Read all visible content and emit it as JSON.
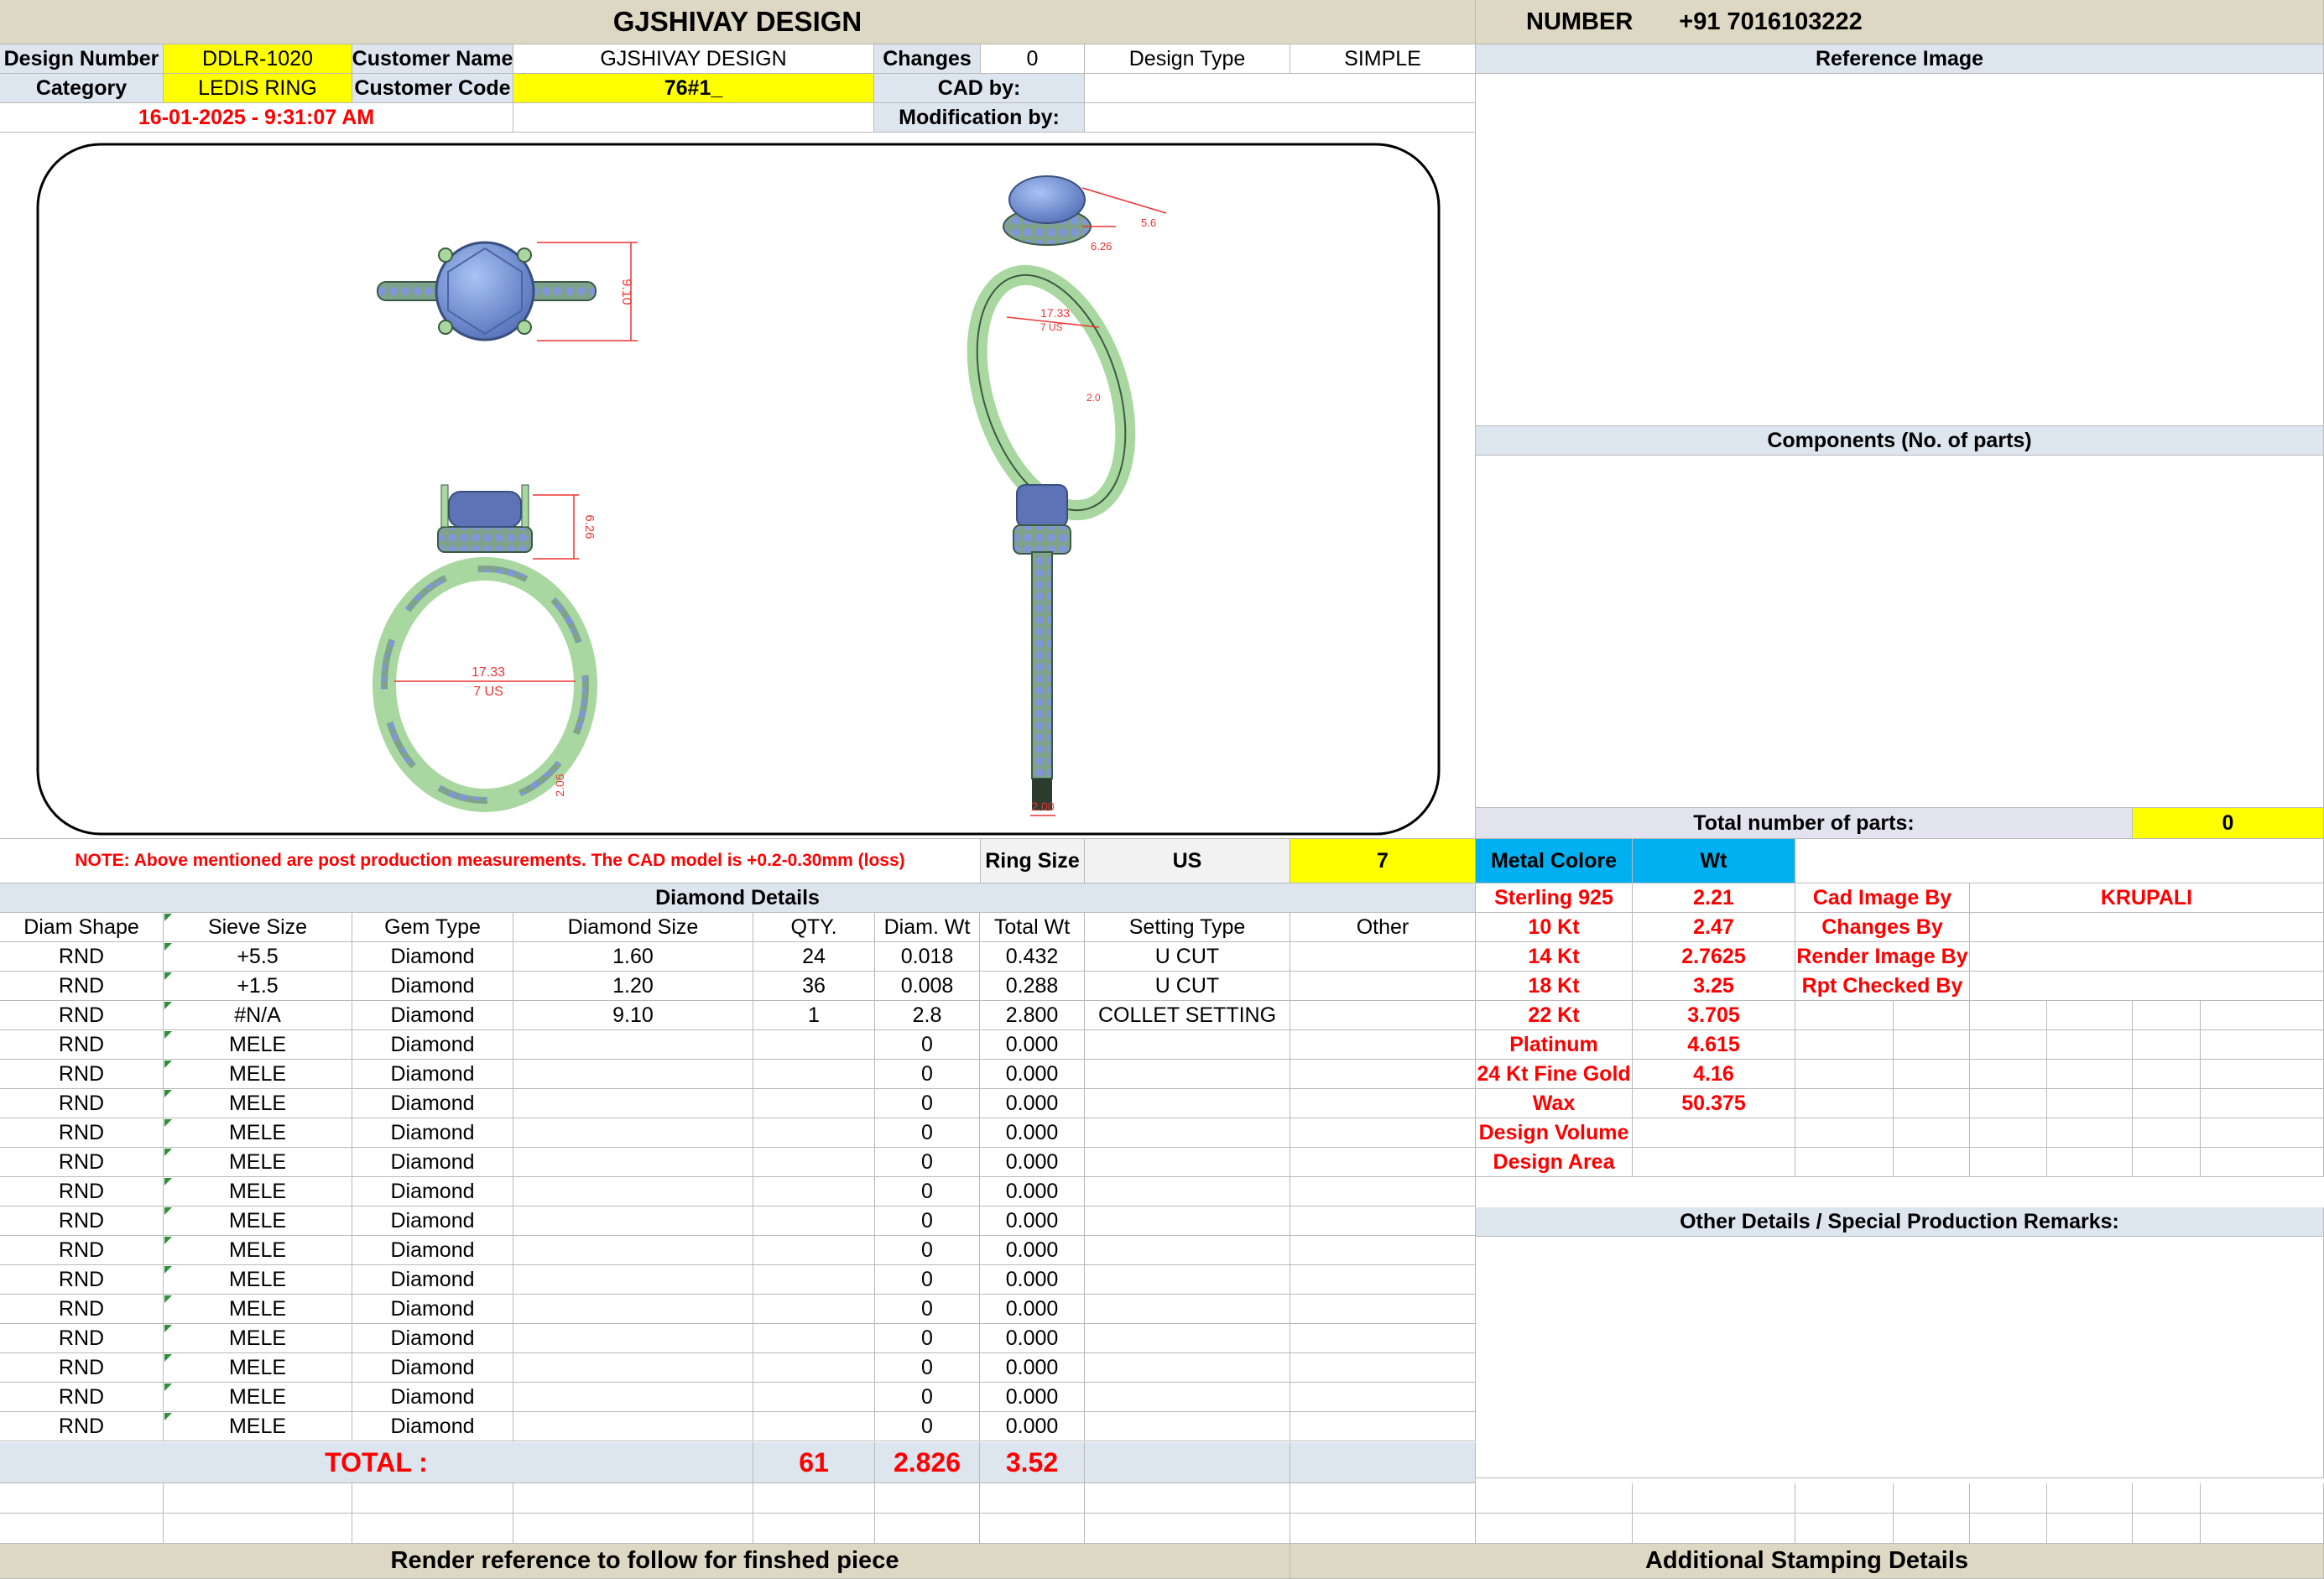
{
  "header": {
    "title": "GJSHIVAY DESIGN",
    "number_label": "NUMBER",
    "phone": "+91 7016103222"
  },
  "info": {
    "design_number_label": "Design Number",
    "design_number": "DDLR-1020",
    "customer_name_label": "Customer Name",
    "customer_name": "GJSHIVAY DESIGN",
    "changes_label": "Changes",
    "changes": "0",
    "design_type_label": "Design Type",
    "design_type": "SIMPLE",
    "category_label": "Category",
    "category": "LEDIS RING",
    "customer_code_label": "Customer Code",
    "customer_code": "76#1_",
    "cad_by_label": "CAD by:",
    "modification_by_label": "Modification by:",
    "timestamp": "16-01-2025 - 9:31:07 AM"
  },
  "reference": {
    "title": "Reference Image"
  },
  "components": {
    "title": "Components (No. of parts)",
    "total_label": "Total number of parts:",
    "total": "0"
  },
  "cad": {
    "top_width": "9.10",
    "side_height": "6.26",
    "side_top": "5.6",
    "side_inner": "17.33",
    "side_inner_us": "7 US",
    "side_shank": "2.0",
    "front_height": "6.26",
    "front_inner": "17.33",
    "front_inner_us": "7 US",
    "front_shank": "2.06",
    "profile_shank": "2.00"
  },
  "note": "NOTE: Above mentioned are post production measurements. The CAD model is +0.2-0.30mm (loss)",
  "ring_size": {
    "label": "Ring Size",
    "system": "US",
    "value": "7"
  },
  "metal": {
    "header_label": "Metal Colore",
    "header_wt": "Wt",
    "rows": [
      {
        "name": "Sterling 925",
        "wt": "2.21"
      },
      {
        "name": "10 Kt",
        "wt": "2.47"
      },
      {
        "name": "14 Kt",
        "wt": "2.7625"
      },
      {
        "name": "18 Kt",
        "wt": "3.25"
      },
      {
        "name": "22 Kt",
        "wt": "3.705"
      },
      {
        "name": "Platinum",
        "wt": "4.615"
      },
      {
        "name": "24 Kt Fine Gold",
        "wt": "4.16"
      },
      {
        "name": "Wax",
        "wt": "50.375"
      },
      {
        "name": "Design Volume",
        "wt": ""
      },
      {
        "name": "Design Area",
        "wt": ""
      }
    ]
  },
  "credits": {
    "rows": [
      {
        "label": "Cad Image By",
        "value": "KRUPALI"
      },
      {
        "label": "Changes By",
        "value": ""
      },
      {
        "label": "Render Image By",
        "value": ""
      },
      {
        "label": "Rpt Checked By",
        "value": ""
      }
    ]
  },
  "remarks": {
    "title": "Other Details / Special Production Remarks:"
  },
  "diamond": {
    "title": "Diamond Details",
    "columns": [
      "Diam Shape",
      "Sieve Size",
      "Gem Type",
      "Diamond Size",
      "QTY.",
      "Diam. Wt",
      "Total Wt",
      "Setting Type",
      "Other"
    ],
    "rows": [
      [
        "RND",
        "+5.5",
        "Diamond",
        "1.60",
        "24",
        "0.018",
        "0.432",
        "U CUT",
        ""
      ],
      [
        "RND",
        "+1.5",
        "Diamond",
        "1.20",
        "36",
        "0.008",
        "0.288",
        "U CUT",
        ""
      ],
      [
        "RND",
        "#N/A",
        "Diamond",
        "9.10",
        "1",
        "2.8",
        "2.800",
        "COLLET SETTING",
        ""
      ],
      [
        "RND",
        "MELE",
        "Diamond",
        "",
        "",
        "0",
        "0.000",
        "",
        ""
      ],
      [
        "RND",
        "MELE",
        "Diamond",
        "",
        "",
        "0",
        "0.000",
        "",
        ""
      ],
      [
        "RND",
        "MELE",
        "Diamond",
        "",
        "",
        "0",
        "0.000",
        "",
        ""
      ],
      [
        "RND",
        "MELE",
        "Diamond",
        "",
        "",
        "0",
        "0.000",
        "",
        ""
      ],
      [
        "RND",
        "MELE",
        "Diamond",
        "",
        "",
        "0",
        "0.000",
        "",
        ""
      ],
      [
        "RND",
        "MELE",
        "Diamond",
        "",
        "",
        "0",
        "0.000",
        "",
        ""
      ],
      [
        "RND",
        "MELE",
        "Diamond",
        "",
        "",
        "0",
        "0.000",
        "",
        ""
      ],
      [
        "RND",
        "MELE",
        "Diamond",
        "",
        "",
        "0",
        "0.000",
        "",
        ""
      ],
      [
        "RND",
        "MELE",
        "Diamond",
        "",
        "",
        "0",
        "0.000",
        "",
        ""
      ],
      [
        "RND",
        "MELE",
        "Diamond",
        "",
        "",
        "0",
        "0.000",
        "",
        ""
      ],
      [
        "RND",
        "MELE",
        "Diamond",
        "",
        "",
        "0",
        "0.000",
        "",
        ""
      ],
      [
        "RND",
        "MELE",
        "Diamond",
        "",
        "",
        "0",
        "0.000",
        "",
        ""
      ],
      [
        "RND",
        "MELE",
        "Diamond",
        "",
        "",
        "0",
        "0.000",
        "",
        ""
      ],
      [
        "RND",
        "MELE",
        "Diamond",
        "",
        "",
        "0",
        "0.000",
        "",
        ""
      ]
    ],
    "total_label": "TOTAL :",
    "total_qty": "61",
    "total_diam_wt": "2.826",
    "total_wt": "3.52"
  },
  "footer": {
    "left": "Render reference to follow for finshed piece",
    "right": "Additional Stamping Details"
  }
}
